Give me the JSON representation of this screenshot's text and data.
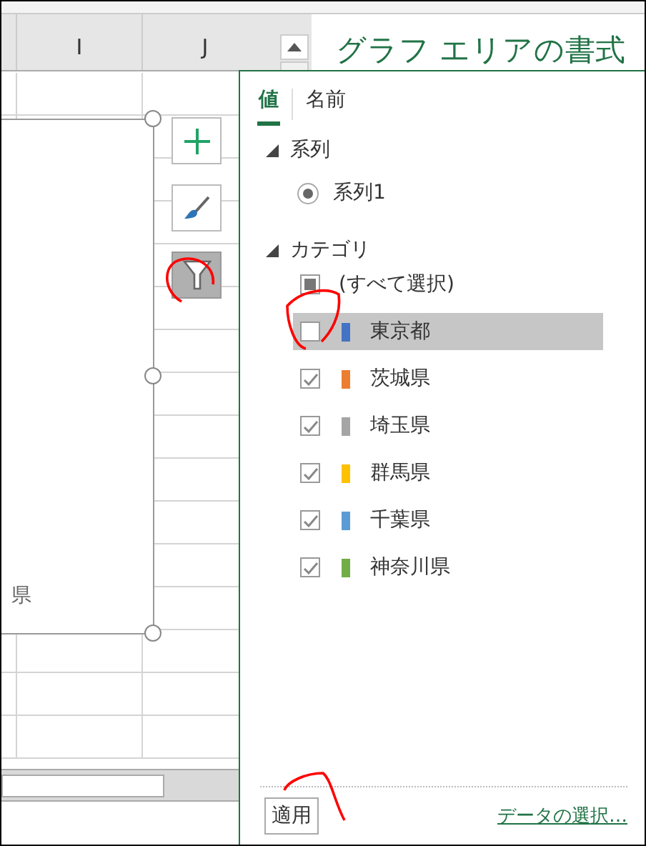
{
  "columns": [
    {
      "label": "I"
    },
    {
      "label": "J"
    }
  ],
  "pane_title": "グラフ エリアの書式",
  "chart": {
    "label": "県"
  },
  "chart_tools": [
    {
      "kind": "add",
      "selected": false
    },
    {
      "kind": "style",
      "selected": false
    },
    {
      "kind": "filter",
      "selected": true
    }
  ],
  "filter_popup": {
    "tabs": [
      {
        "label": "値",
        "selected": true
      },
      {
        "label": "名前",
        "selected": false
      }
    ],
    "series_section": {
      "label": "系列",
      "expanded": true,
      "items": [
        {
          "label": "系列1",
          "selected": true
        }
      ]
    },
    "category_section": {
      "label": "カテゴリ",
      "expanded": true,
      "select_all": {
        "label": "(すべて選択)",
        "indeterminate": true
      },
      "items": [
        {
          "label": "東京都",
          "checked": false,
          "highlighted": true,
          "color": "#4472c4"
        },
        {
          "label": "茨城県",
          "checked": true,
          "highlighted": false,
          "color": "#ed7d31"
        },
        {
          "label": "埼玉県",
          "checked": true,
          "highlighted": false,
          "color": "#a5a5a5"
        },
        {
          "label": "群馬県",
          "checked": true,
          "highlighted": false,
          "color": "#ffc000"
        },
        {
          "label": "千葉県",
          "checked": true,
          "highlighted": false,
          "color": "#5b9bd5"
        },
        {
          "label": "神奈川県",
          "checked": true,
          "highlighted": false,
          "color": "#70ad47"
        }
      ]
    },
    "apply_button": "適用",
    "select_data_link": "データの選択…"
  }
}
